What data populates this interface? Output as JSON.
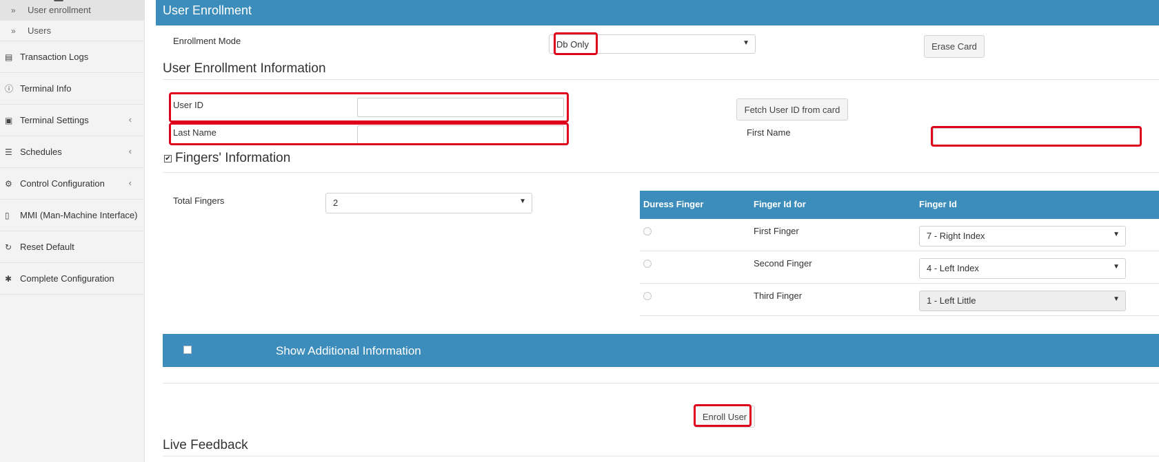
{
  "sidebar": {
    "subitems": [
      {
        "label": "User enrollment",
        "icon": "double-chevron-right-icon"
      },
      {
        "label": "Users",
        "icon": "double-chevron-right-icon"
      }
    ],
    "items": [
      {
        "label": "Transaction Logs",
        "icon": "file-icon"
      },
      {
        "label": "Terminal Info",
        "icon": "info-circle-icon"
      },
      {
        "label": "Terminal Settings",
        "icon": "camera-icon"
      },
      {
        "label": "Schedules",
        "icon": "list-icon"
      },
      {
        "label": "Control Configuration",
        "icon": "gears-icon"
      },
      {
        "label": "MMI (Man-Machine Interface)",
        "icon": "mobile-icon"
      },
      {
        "label": "Reset Default",
        "icon": "refresh-icon"
      },
      {
        "label": "Complete Configuration",
        "icon": "gear-icon"
      }
    ]
  },
  "header": {
    "title": "User Enrollment"
  },
  "enrollment": {
    "mode_label": "Enrollment Mode",
    "mode_value": "Db Only",
    "erase_button": "Erase Card"
  },
  "info": {
    "title": "User Enrollment Information",
    "user_id_label": "User ID",
    "user_id_value": "",
    "fetch_button": "Fetch User ID from card",
    "last_name_label": "Last Name",
    "last_name_value": "",
    "first_name_label": "First Name",
    "first_name_value": ""
  },
  "fingers": {
    "title": "Fingers' Information",
    "checked": true,
    "total_label": "Total Fingers",
    "total_value": "2",
    "table": {
      "headers": [
        "Duress Finger",
        "Finger Id for",
        "Finger Id"
      ],
      "rows": [
        {
          "label": "First Finger",
          "value": "7 - Right Index",
          "disabled": false
        },
        {
          "label": "Second Finger",
          "value": "4 - Left Index",
          "disabled": false
        },
        {
          "label": "Third Finger",
          "value": "1 - Left Little",
          "disabled": true
        }
      ]
    }
  },
  "additional": {
    "label": "Show Additional Information"
  },
  "enroll_button": "Enroll User",
  "live_feedback": {
    "title": "Live Feedback"
  },
  "colors": {
    "accent": "#3c8dbc",
    "highlight": "#e0001b"
  }
}
